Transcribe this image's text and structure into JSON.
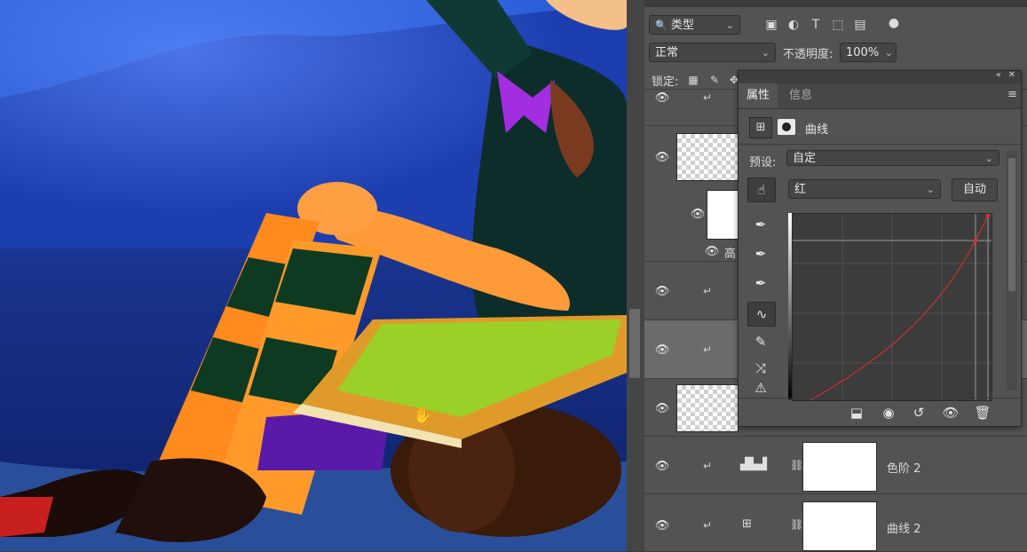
{
  "filter": {
    "value": "类型"
  },
  "blend_mode": {
    "value": "正常"
  },
  "opacity": {
    "label": "不透明度:",
    "value": "100%"
  },
  "lock": {
    "label": "锁定:"
  },
  "properties": {
    "tabs": [
      {
        "label": "属性"
      },
      {
        "label": "信息"
      }
    ],
    "adjustment_name": "曲线",
    "preset_label": "预设:",
    "preset_value": "自定",
    "channel_value": "红",
    "auto_label": "自动"
  },
  "layers": [
    {
      "name": "高"
    },
    {
      "name": "色阶 2"
    },
    {
      "name": "曲线 2"
    }
  ],
  "colors": {
    "curve_red": "#d03030",
    "panel_bg": "#535353"
  }
}
